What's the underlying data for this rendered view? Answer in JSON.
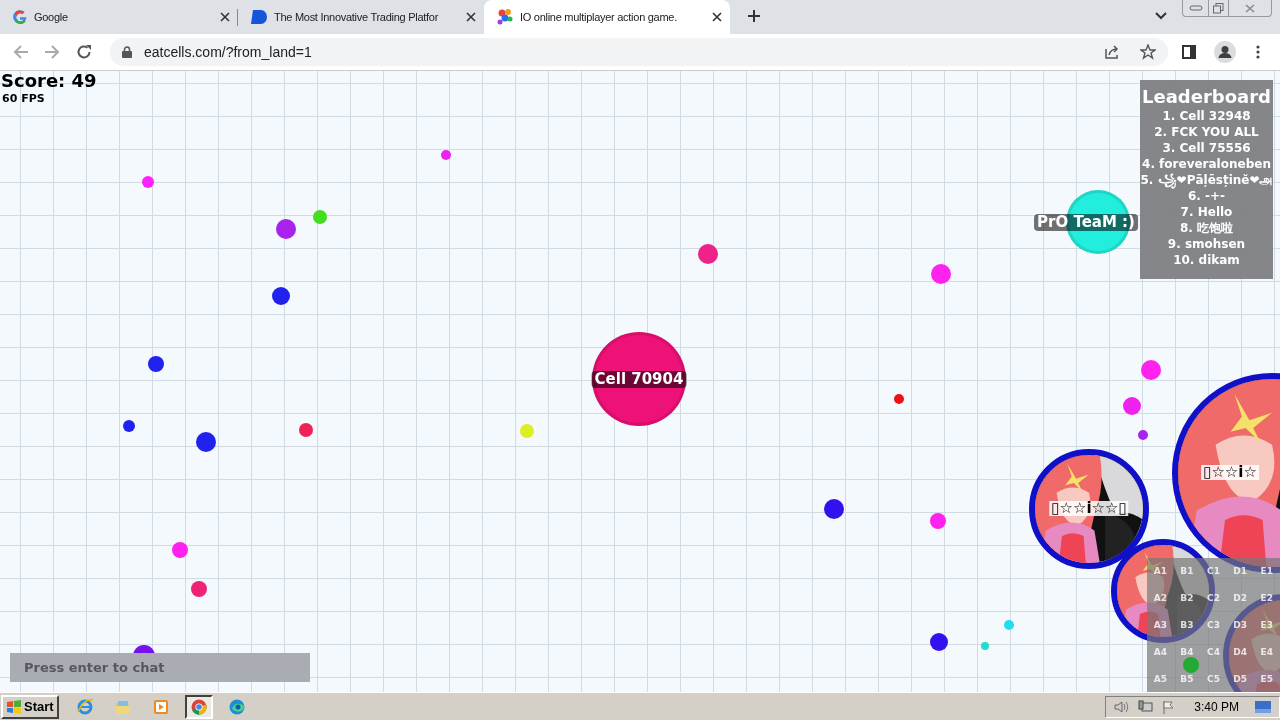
{
  "browser": {
    "tabs": [
      {
        "kind": "google",
        "title": "Google",
        "selected": false
      },
      {
        "kind": "trading",
        "title": "The Most Innovative Trading Platfor",
        "selected": false
      },
      {
        "kind": "game",
        "title": "IO online multiplayer action game.",
        "selected": true
      }
    ],
    "address": "eatcells.com/?from_land=1"
  },
  "game": {
    "score": "Score: 49",
    "fps": "60 FPS",
    "leaderboard": {
      "title": "Leaderboard",
      "entries": [
        "1. Cell 32948",
        "2. FCK YOU ALL",
        "3. Cell 75556",
        "4. foreveraloneben",
        "5. ꧁❤Pāļēsținĕ❤அ",
        "6. -+-",
        "7. Hello",
        "8. 吃饱啦",
        "9. smohsen",
        "10. dikam"
      ]
    },
    "pellets": [
      {
        "color": "#ff22ff"
      },
      {
        "color": "#ee22ee"
      },
      {
        "color": "#44dd22"
      },
      {
        "color": "#aa22ee"
      },
      {
        "color": "#ee2288"
      },
      {
        "color": "#ff22ee"
      },
      {
        "color": "#2222ee"
      },
      {
        "color": "#2222ee"
      },
      {
        "color": "#2222ee"
      },
      {
        "color": "#2222ee"
      },
      {
        "color": "#ee2255"
      },
      {
        "color": "#ddee22"
      },
      {
        "color": "#ee1111"
      },
      {
        "color": "#3311ee"
      },
      {
        "color": "#ff22ee"
      },
      {
        "color": "#ff22ee"
      },
      {
        "color": "#ee2277"
      },
      {
        "color": "#7711ee"
      },
      {
        "color": "#3311ee"
      },
      {
        "color": "#22ddee"
      },
      {
        "color": "#22ddcc"
      },
      {
        "color": "#ff22ee"
      },
      {
        "color": "#ee22ee"
      },
      {
        "color": "#aa22ee"
      },
      {
        "color": "#22aa33"
      }
    ],
    "cells": [
      {
        "kind": "plain",
        "name": "Cell 70904",
        "color": "#ee1177"
      },
      {
        "kind": "plain",
        "name": "PrO TeaM :)",
        "color": "#22eedd"
      },
      {
        "kind": "skin",
        "name": "▯☆☆i☆☆▯"
      },
      {
        "kind": "skin"
      },
      {
        "kind": "skin",
        "name": "▯☆☆i☆"
      },
      {
        "kind": "skin"
      }
    ],
    "minimap": {
      "labels": [
        "A1",
        "B1",
        "C1",
        "D1",
        "E1",
        "A2",
        "B2",
        "C2",
        "D2",
        "E2",
        "A3",
        "B3",
        "C3",
        "D3",
        "E3",
        "A4",
        "B4",
        "C4",
        "D4",
        "E4",
        "A5",
        "B5",
        "C5",
        "D5",
        "E5"
      ]
    },
    "chat": {
      "placeholder": "Press enter to chat"
    }
  },
  "taskbar": {
    "start": "Start",
    "apps": [
      {
        "kind": "ie",
        "selected": false
      },
      {
        "kind": "folder",
        "selected": false
      },
      {
        "kind": "media",
        "selected": false
      },
      {
        "kind": "chrome",
        "selected": true
      },
      {
        "kind": "edge",
        "selected": false
      }
    ],
    "clock": "3:40 PM"
  }
}
